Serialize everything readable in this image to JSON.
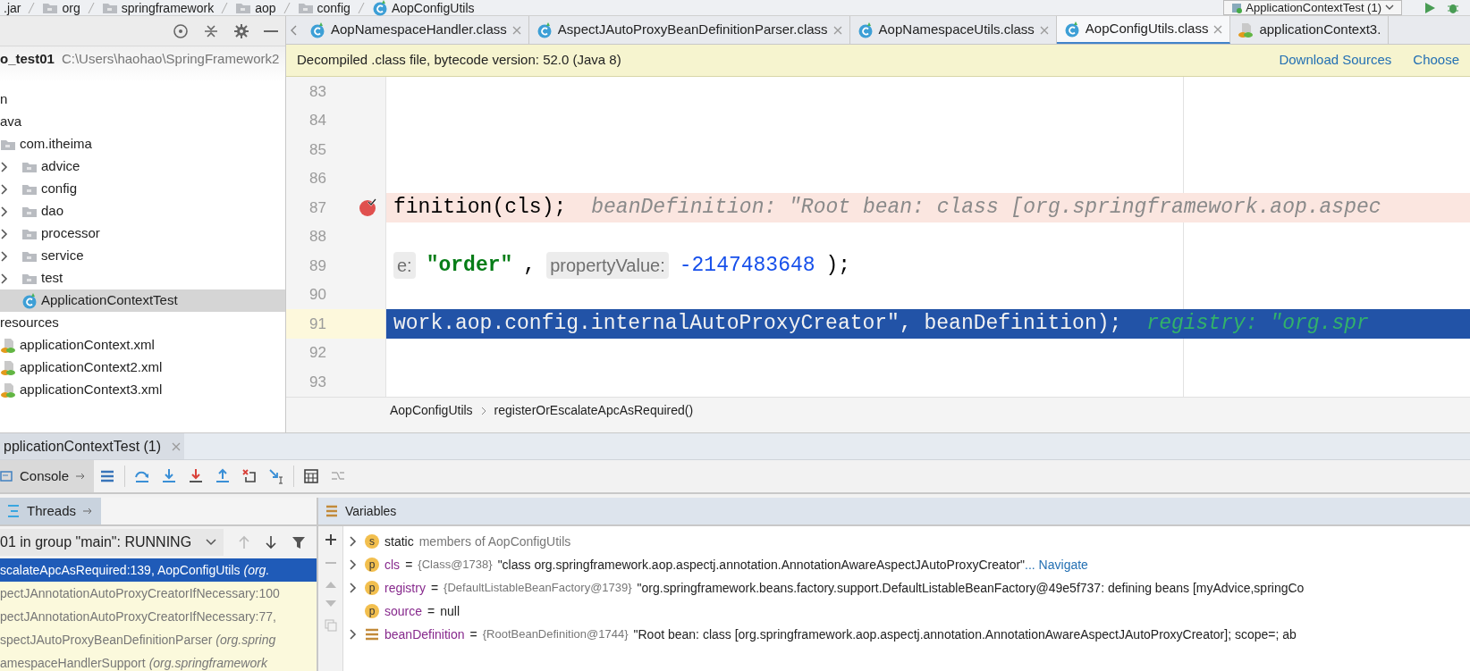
{
  "nav_bar": {
    "path": [
      {
        "label": ".jar"
      },
      {
        "label": "org",
        "kind": "folder"
      },
      {
        "label": "springframework",
        "kind": "folder"
      },
      {
        "label": "aop",
        "kind": "folder"
      },
      {
        "label": "config",
        "kind": "folder"
      },
      {
        "label": "AopConfigUtils",
        "kind": "class"
      }
    ],
    "run_config": "ApplicationContextTest (1)"
  },
  "project": {
    "root": {
      "name": "o_test01",
      "path": "C:\\Users\\haohao\\SpringFramework2"
    },
    "tree": [
      {
        "label": "n",
        "selected": false
      },
      {
        "label": "ava",
        "selected": false,
        "children": [
          {
            "label": "com.itheima",
            "kind": "package",
            "selected": false,
            "children": [
              {
                "label": "advice",
                "kind": "package",
                "expanded": false,
                "selected": false
              },
              {
                "label": "config",
                "kind": "package",
                "expanded": false,
                "selected": false
              },
              {
                "label": "dao",
                "kind": "package",
                "expanded": false,
                "selected": false
              },
              {
                "label": "processor",
                "kind": "package",
                "expanded": false,
                "selected": false
              },
              {
                "label": "service",
                "kind": "package",
                "expanded": false,
                "selected": false
              },
              {
                "label": "test",
                "kind": "package",
                "expanded": false,
                "selected": false
              },
              {
                "label": "ApplicationContextTest",
                "kind": "class",
                "selected": true
              }
            ]
          }
        ]
      },
      {
        "label": "resources",
        "selected": false,
        "children": [
          {
            "label": "applicationContext.xml",
            "kind": "xml",
            "selected": false
          },
          {
            "label": "applicationContext2.xml",
            "kind": "xml",
            "selected": false
          },
          {
            "label": "applicationContext3.xml",
            "kind": "xml",
            "selected": false
          }
        ]
      }
    ]
  },
  "editor": {
    "tabs": [
      {
        "label": "AopNamespaceHandler.class",
        "kind": "class",
        "selected": false,
        "closable": true
      },
      {
        "label": "AspectJAutoProxyBeanDefinitionParser.class",
        "kind": "class",
        "selected": false,
        "closable": true
      },
      {
        "label": "AopNamespaceUtils.class",
        "kind": "class",
        "selected": false,
        "closable": true
      },
      {
        "label": "AopConfigUtils.class",
        "kind": "class",
        "selected": true,
        "closable": true
      },
      {
        "label": "applicationContext3.",
        "kind": "xml",
        "selected": false,
        "closable": false
      }
    ],
    "notice": {
      "text": "Decompiled .class file, bytecode version: 52.0 (Java 8)",
      "actions": [
        "Download Sources",
        "Choose"
      ]
    },
    "lines": [
      {
        "number": "83",
        "kind": "plain"
      },
      {
        "number": "84",
        "kind": "plain"
      },
      {
        "number": "85",
        "kind": "plain"
      },
      {
        "number": "86",
        "kind": "plain"
      },
      {
        "number": "87",
        "kind": "breakpoint",
        "tokens": [
          {
            "kind": "code",
            "text": "finition(cls);"
          },
          {
            "kind": "inline_value",
            "text": "beanDefinition: \"Root bean: class [org.springframework.aop.aspec"
          }
        ]
      },
      {
        "number": "88",
        "kind": "plain"
      },
      {
        "number": "89",
        "kind": "plain",
        "tokens": [
          {
            "kind": "param_hint",
            "text": "e:"
          },
          {
            "kind": "string",
            "text": "\"order\""
          },
          {
            "kind": "code",
            "text": ","
          },
          {
            "kind": "param_hint",
            "text": "propertyValue:"
          },
          {
            "kind": "number",
            "text": "-2147483648"
          },
          {
            "kind": "code",
            "text": ");"
          }
        ]
      },
      {
        "number": "90",
        "kind": "plain"
      },
      {
        "number": "91",
        "kind": "execution",
        "tokens": [
          {
            "kind": "code",
            "text": "work.aop.config.internalAutoProxyCreator\", beanDefinition);"
          },
          {
            "kind": "inline_value",
            "text": "registry: \"org.spr"
          }
        ]
      },
      {
        "number": "92",
        "kind": "plain"
      },
      {
        "number": "93",
        "kind": "plain"
      }
    ],
    "breadcrumb": [
      "AopConfigUtils",
      "registerOrEscalateApcAsRequired()"
    ]
  },
  "debug": {
    "session_tab": "pplicationContextTest (1)",
    "console_tab": "Console",
    "threads_title": "Threads",
    "variables_title": "Variables",
    "thread": "01 in group \"main\": RUNNING",
    "frames": [
      {
        "method": "scalateApcAsRequired:139, AopConfigUtils",
        "package": "(org.",
        "selected": true
      },
      {
        "method": "pectJAnnotationAutoProxyCreatorIfNecessary:100",
        "selected": false
      },
      {
        "method": "pectJAnnotationAutoProxyCreatorIfNecessary:77,",
        "selected": false
      },
      {
        "method": "spectJAutoProxyBeanDefinitionParser",
        "package": "(org.spring",
        "selected": false
      },
      {
        "method": "amespaceHandlerSupport",
        "package": "(org.springframework",
        "selected": false
      }
    ],
    "variables": [
      {
        "kind": "static",
        "badge": "s",
        "name": "static",
        "detail": "members of AopConfigUtils",
        "expanded": false
      },
      {
        "kind": "param",
        "badge": "p",
        "name": "cls",
        "separator": "=",
        "type": "{Class@1738}",
        "value": "\"class org.springframework.aop.aspectj.annotation.AnnotationAwareAspectJAutoProxyCreator\"",
        "link": "... Navigate",
        "expanded": false
      },
      {
        "kind": "param",
        "badge": "p",
        "name": "registry",
        "separator": "=",
        "type": "{DefaultListableBeanFactory@1739}",
        "value": "\"org.springframework.beans.factory.support.DefaultListableBeanFactory@49e5f737: defining beans [myAdvice,springCo",
        "expanded": false
      },
      {
        "kind": "param",
        "badge": "p",
        "name": "source",
        "separator": "=",
        "value": "null"
      },
      {
        "kind": "local",
        "name": "beanDefinition",
        "separator": "=",
        "type": "{RootBeanDefinition@1744}",
        "value": "\"Root bean: class [org.springframework.aop.aspectj.annotation.AnnotationAwareAspectJAutoProxyCreator]; scope=; ab",
        "expanded": false
      }
    ]
  }
}
